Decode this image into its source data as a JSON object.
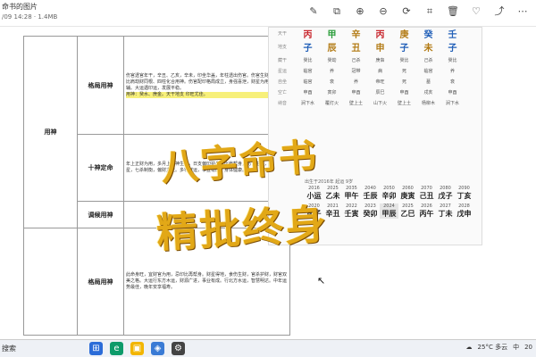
{
  "window": {
    "title": "命书的图片",
    "subtitle": "/09 14:28 · 1.4MB"
  },
  "toolbar": {
    "icons": [
      "pen-icon",
      "copy-icon",
      "zoom-in-icon",
      "zoom-out-icon",
      "rotate-icon",
      "crop-icon",
      "delete-icon",
      "favorite-icon",
      "share-icon",
      "more-icon"
    ]
  },
  "rows": [
    {
      "section": "用神",
      "label": "格局用神",
      "text": "伤官透官年干，辛丑、乙亥，辛未，印坐华盖，年柱透出伤官。伤官生财。大运。比肩劫财同根、四柱化合用神。伤官配印格局成立，身强喜泄，财星为用。印星为辅。大运遇印运，发展平稳。",
      "note": "用神：癸水、庚金。天干地支 印旺尤佳。"
    },
    {
      "section": "",
      "label": "十神定命",
      "text": "年上正财为用，多月上食神生财，日支偏印护身，比肩帮身，伤官生财，正官为官星，七杀制衡，偏财主父。多行财运，事业有成，身体健康。"
    },
    {
      "section": "",
      "label": "调候用神",
      "text": ""
    },
    {
      "section": "",
      "label": "格局用神",
      "text": "此命身旺，宜财官为用，忌印比再帮身。财星得地，食伤生财，官杀护财，财官双美之格。大运行东方木运，财源广进，事业有成。行北方水运，智慧明达。中年运势最佳，晚年安享福寿。"
    }
  ],
  "panel": {
    "labels": {
      "tiangan": "天干",
      "dizhi": "地支",
      "canggan": "藏干",
      "xingyun": "星运",
      "zizuo": "自坐",
      "kongwang": "空亡",
      "nayin": "纳音",
      "shensha": "神煞"
    },
    "tiangan": [
      "丙",
      "甲",
      "辛",
      "丙",
      "庚",
      "癸",
      "壬"
    ],
    "dizhi": [
      "子",
      "辰",
      "丑",
      "申",
      "子",
      "未",
      "子"
    ],
    "canggan": [
      "癸比",
      "癸劫",
      "己杀",
      "庚枭",
      "癸比",
      "己杀",
      "癸比"
    ],
    "rows": [
      {
        "label": "星运",
        "values": [
          "临官",
          "养",
          "冠带",
          "病",
          "死",
          "临官",
          "养"
        ]
      },
      {
        "label": "自坐",
        "values": [
          "临官",
          "衰",
          "养",
          "帝旺",
          "死",
          "墓",
          "衰"
        ]
      },
      {
        "label": "空亡",
        "values": [
          "申酉",
          "寅卯",
          "申酉",
          "辰巳",
          "申酉",
          "戌亥",
          "申酉"
        ]
      },
      {
        "label": "纳音",
        "values": [
          "涧下水",
          "覆灯火",
          "壁上土",
          "山下火",
          "壁上土",
          "杨柳木",
          "涧下水"
        ]
      }
    ],
    "dayun_label": "大运",
    "dayun_note": "出生于2016年 起运 9岁",
    "dayun_years": [
      "2016",
      "2025",
      "2035",
      "2040",
      "2050",
      "2060",
      "2070",
      "2080",
      "2090"
    ],
    "dayun_pillars": [
      "小运",
      "乙未",
      "甲午",
      "壬辰",
      "辛卯",
      "庚寅",
      "己丑",
      "戊子",
      "丁亥"
    ],
    "liunian_years": [
      "2020",
      "2021",
      "2022",
      "2023",
      "2024",
      "2025",
      "2026",
      "2027",
      "2028",
      "2029"
    ],
    "liunian_pillars": [
      "庚子",
      "辛丑",
      "壬寅",
      "癸卯",
      "甲辰",
      "乙巳",
      "丙午",
      "丁未",
      "戊申",
      "己酉"
    ],
    "liunian_selected": "2024"
  },
  "stamp": {
    "line1": "八字命书",
    "line2": "精批终身"
  },
  "taskbar": {
    "search": "搜索",
    "weather": "25°C 多云",
    "lang": "中",
    "clock": "20"
  }
}
